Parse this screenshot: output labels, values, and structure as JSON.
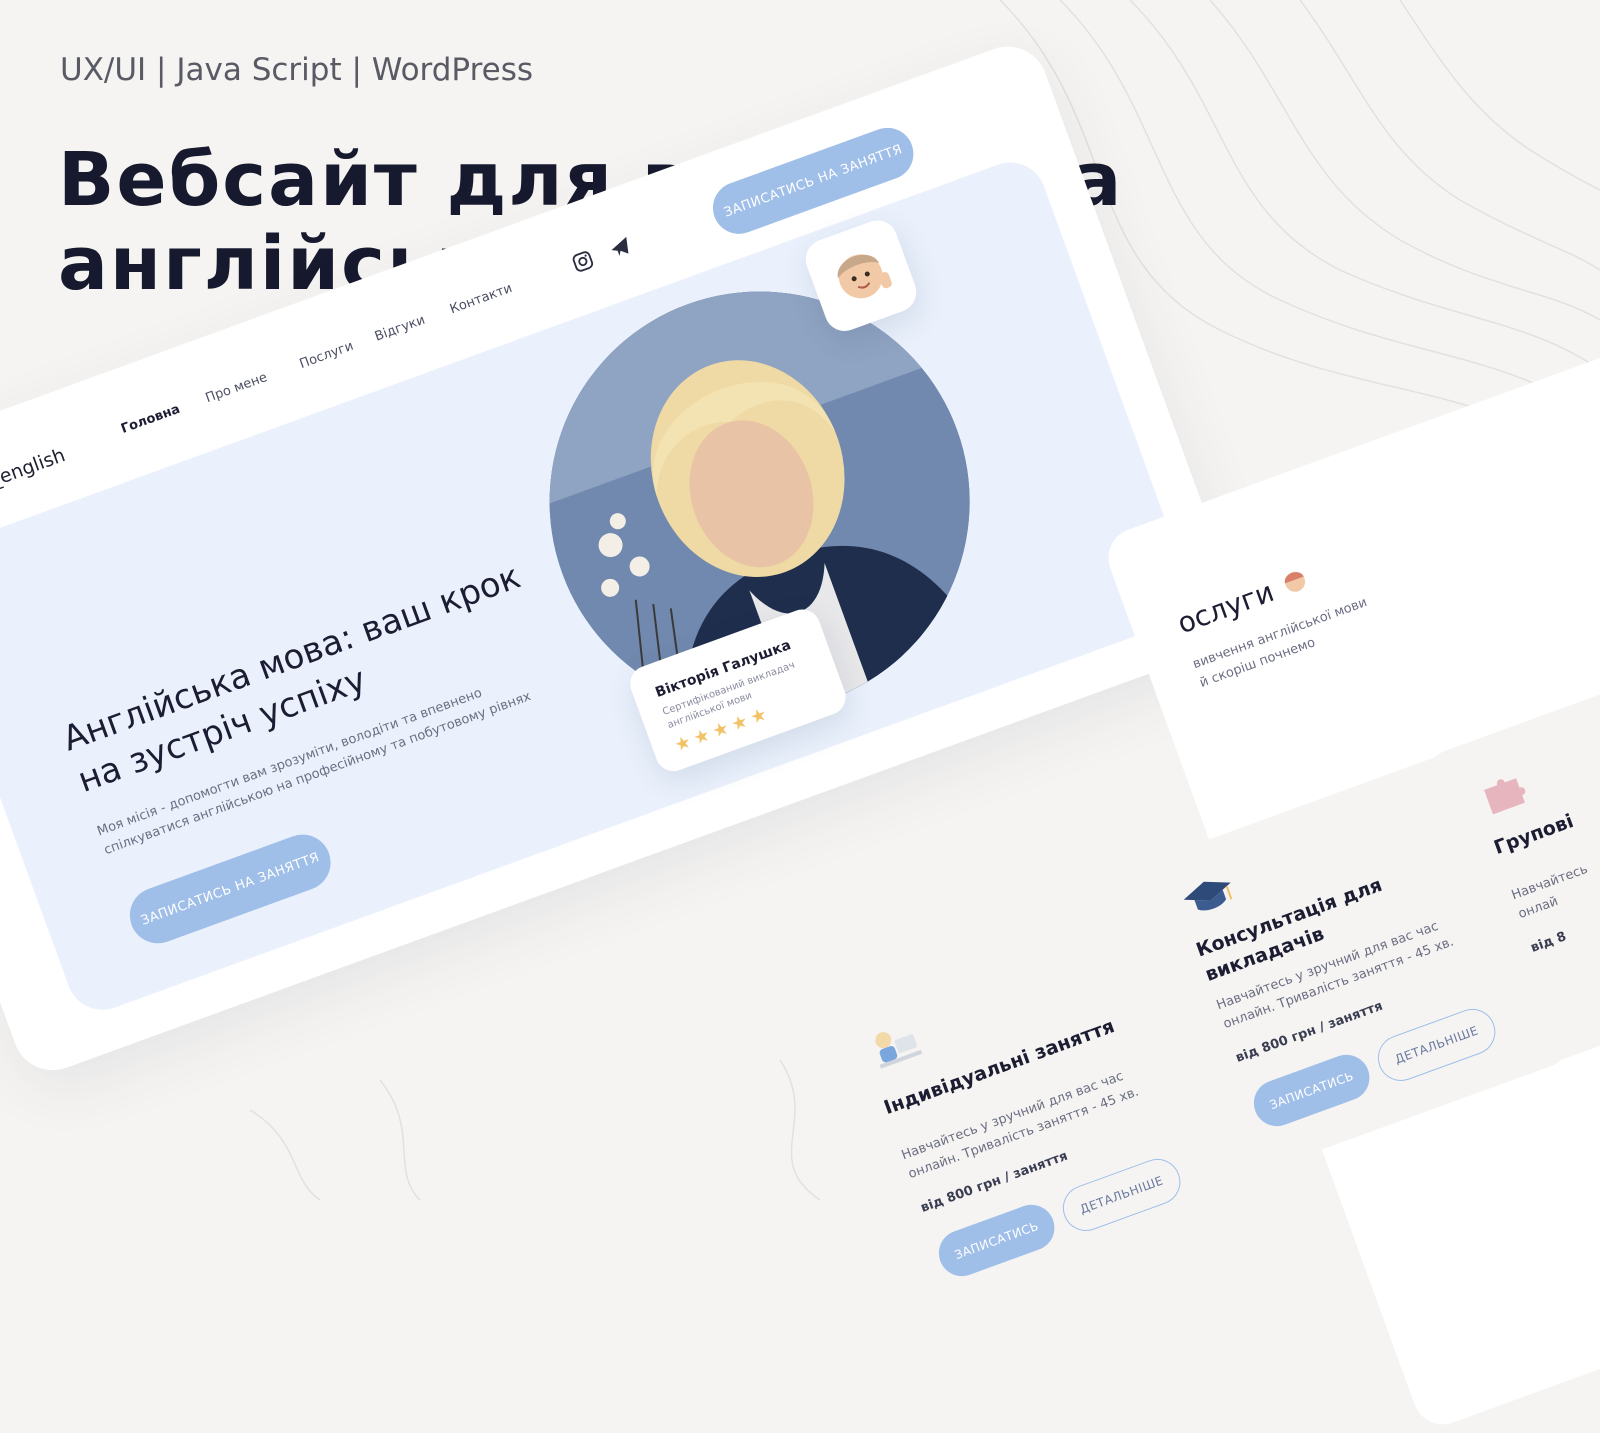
{
  "header": {
    "tags": "UX/UI | Java Script | WordPress",
    "title": "Вебсайт для викладача англійської"
  },
  "site": {
    "logo": "_english",
    "nav": [
      "Головна",
      "Про мене",
      "Послуги",
      "Відгуки",
      "Контакти"
    ],
    "cta_top": "ЗАПИСАТИСЬ НА ЗАНЯТТЯ",
    "hero_heading": "Англійська мова: ваш крок на зустріч успіху",
    "hero_text": "Моя місія - допомогти вам зрозуміти, володіти та впевнено спілкуватися англійською на професійному та побутовому рівнях",
    "cta_hero": "ЗАПИСАТИСЬ НА ЗАНЯТТЯ",
    "teacher_name": "Вікторія Галушка",
    "teacher_role": "Сертифікований викладач англійської мови",
    "rating": 5,
    "stars": "★★★★★",
    "icons": [
      "instagram-icon",
      "telegram-icon"
    ]
  },
  "services": {
    "title": "ослуги",
    "subtitle_1": "вивчення англійської мови",
    "subtitle_2": "й скоріш почнемо",
    "cards": [
      {
        "title": "Індивідуальні заняття",
        "desc": "Навчайтесь у зручний для вас час онлайн. Тривалість заняття - 45 хв.",
        "price": "від 800 грн / заняття",
        "btn_primary": "ЗАПИСАТИСЬ",
        "btn_secondary": "ДЕТАЛЬНІШЕ"
      },
      {
        "title": "Консультація для викладачів",
        "desc": "Навчайтесь у зручний для вас час онлайн. Тривалість заняття - 45 хв.",
        "price": "від 800 грн / заняття",
        "btn_primary": "ЗАПИСАТИСЬ",
        "btn_secondary": "ДЕТАЛЬНІШЕ"
      },
      {
        "title": "Групові",
        "desc": "Навчайтесь онлай",
        "price": "від 8"
      }
    ]
  },
  "colors": {
    "background": "#f5f4f2",
    "accent": "#9fbfe9",
    "hero_bg": "#eaf1fc",
    "star": "#f3c267",
    "text_dark": "#171a2e"
  }
}
